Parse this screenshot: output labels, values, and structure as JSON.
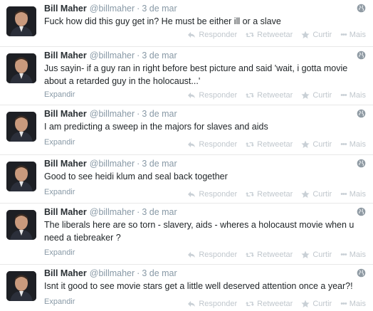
{
  "tweets": [
    {
      "name": "Bill Maher",
      "handle": "@billmaher",
      "separator": "·",
      "time": "3 de mar",
      "text": "Fuck how did this guy get in? He must be either ill or a slave",
      "expand": "",
      "actions": {
        "reply": "Responder",
        "retweet": "Retweetar",
        "favorite": "Curtir",
        "more": "Mais"
      }
    },
    {
      "name": "Bill Maher",
      "handle": "@billmaher",
      "separator": "·",
      "time": "3 de mar",
      "text": "Jus sayin- if a guy ran in right before best picture and said 'wait, i gotta movie about a retarded guy in the holocaust...'",
      "expand": "Expandir",
      "actions": {
        "reply": "Responder",
        "retweet": "Retweetar",
        "favorite": "Curtir",
        "more": "Mais"
      }
    },
    {
      "name": "Bill Maher",
      "handle": "@billmaher",
      "separator": "·",
      "time": "3 de mar",
      "text": "I am predicting a sweep in the majors for slaves and aids",
      "expand": "Expandir",
      "actions": {
        "reply": "Responder",
        "retweet": "Retweetar",
        "favorite": "Curtir",
        "more": "Mais"
      }
    },
    {
      "name": "Bill Maher",
      "handle": "@billmaher",
      "separator": "·",
      "time": "3 de mar",
      "text": "Good to see heidi klum and seal back together",
      "expand": "Expandir",
      "actions": {
        "reply": "Responder",
        "retweet": "Retweetar",
        "favorite": "Curtir",
        "more": "Mais"
      }
    },
    {
      "name": "Bill Maher",
      "handle": "@billmaher",
      "separator": "·",
      "time": "3 de mar",
      "text": "The liberals here are so torn - slavery, aids - wheres a holocaust movie when u need a tiebreaker ?",
      "expand": "Expandir",
      "actions": {
        "reply": "Responder",
        "retweet": "Retweetar",
        "favorite": "Curtir",
        "more": "Mais"
      }
    },
    {
      "name": "Bill Maher",
      "handle": "@billmaher",
      "separator": "·",
      "time": "3 de mar",
      "text": "Isnt it good to see movie stars get a little well deserved attention once a year?!",
      "expand": "Expandir",
      "actions": {
        "reply": "Responder",
        "retweet": "Retweetar",
        "favorite": "Curtir",
        "more": "Mais"
      }
    }
  ],
  "colors": {
    "name": "#292f33",
    "meta": "#8899a6",
    "action": "#c0c7cd",
    "divider": "#e8e8e8"
  }
}
